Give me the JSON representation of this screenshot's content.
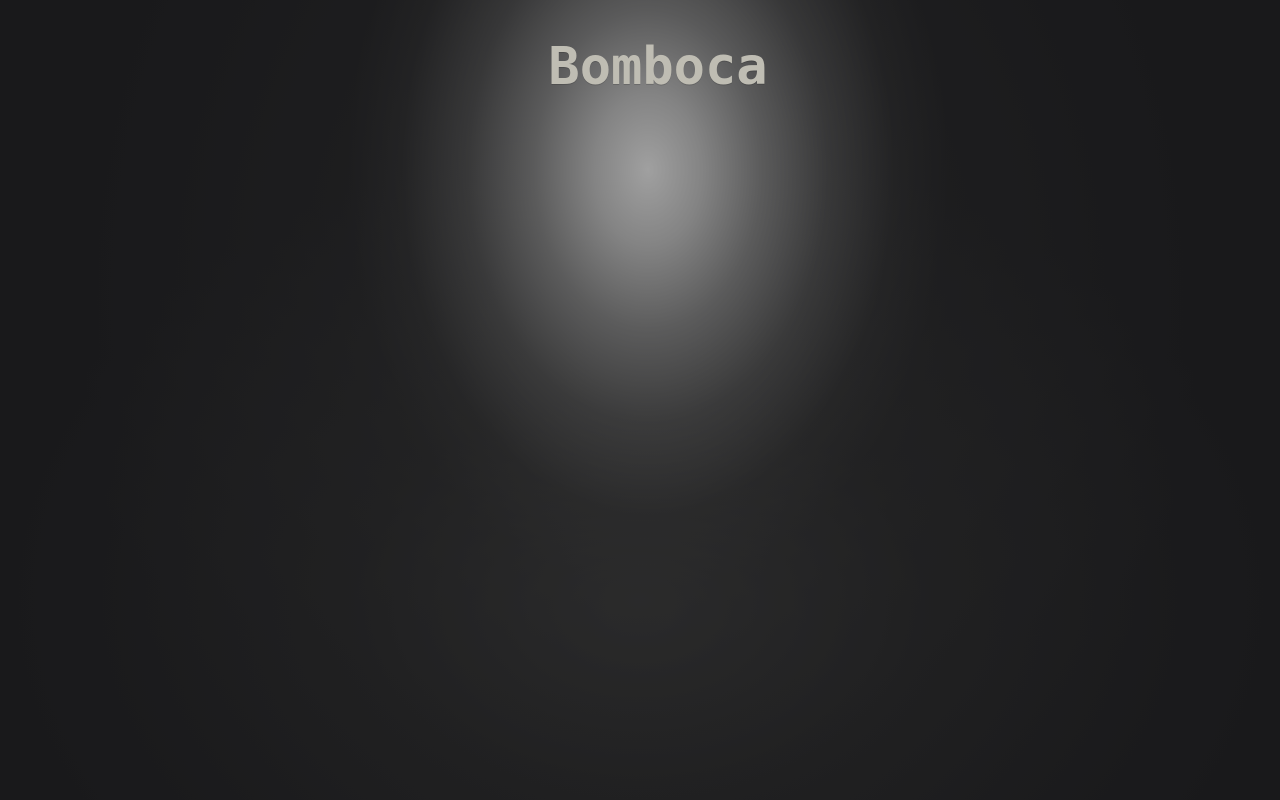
{
  "page": {
    "title": "Bomboca"
  },
  "colors": {
    "background": "#19191b",
    "spotlight": "#a0a0a0",
    "title_text": "#bfbdb3"
  }
}
